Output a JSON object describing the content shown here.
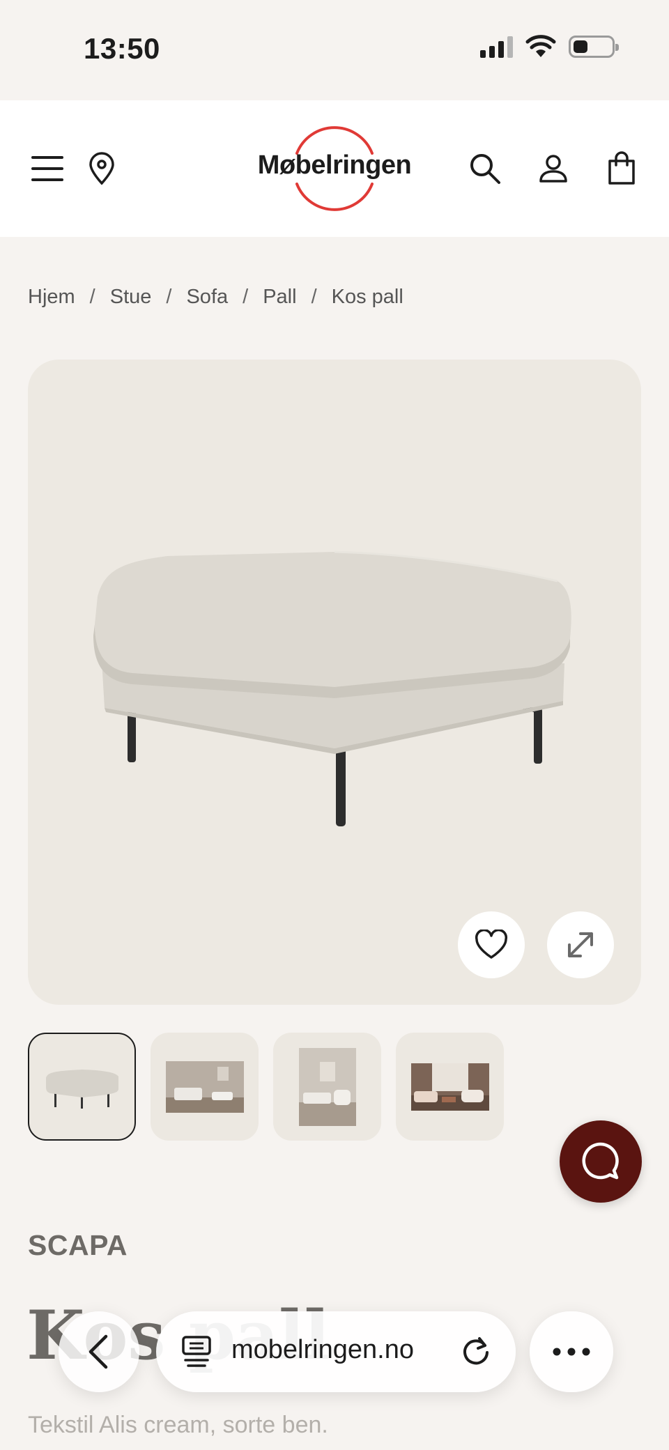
{
  "status_bar": {
    "time": "13:50",
    "icons": [
      "cellular-signal-icon",
      "wifi-icon",
      "battery-icon"
    ]
  },
  "header": {
    "logo_text": "Møbelringen",
    "brand_color": "#e03a36",
    "icons": [
      "menu-icon",
      "location-pin-icon",
      "search-icon",
      "user-icon",
      "shopping-bag-icon"
    ]
  },
  "breadcrumb": {
    "items": [
      "Hjem",
      "Stue",
      "Sofa",
      "Pall",
      "Kos pall"
    ],
    "separator": "/"
  },
  "gallery": {
    "actions": [
      "heart-icon",
      "expand-icon"
    ],
    "thumbnail_count": 4
  },
  "chat": {
    "color": "#5a1410",
    "icon": "chat-icon"
  },
  "product": {
    "brand": "SCAPA",
    "title": "Kos pall",
    "description": "Tekstil Alis cream, sorte ben."
  },
  "browser": {
    "url": "mobelringen.no",
    "icons": [
      "back-chevron-icon",
      "tabs-icon",
      "reload-icon",
      "more-icon"
    ]
  }
}
